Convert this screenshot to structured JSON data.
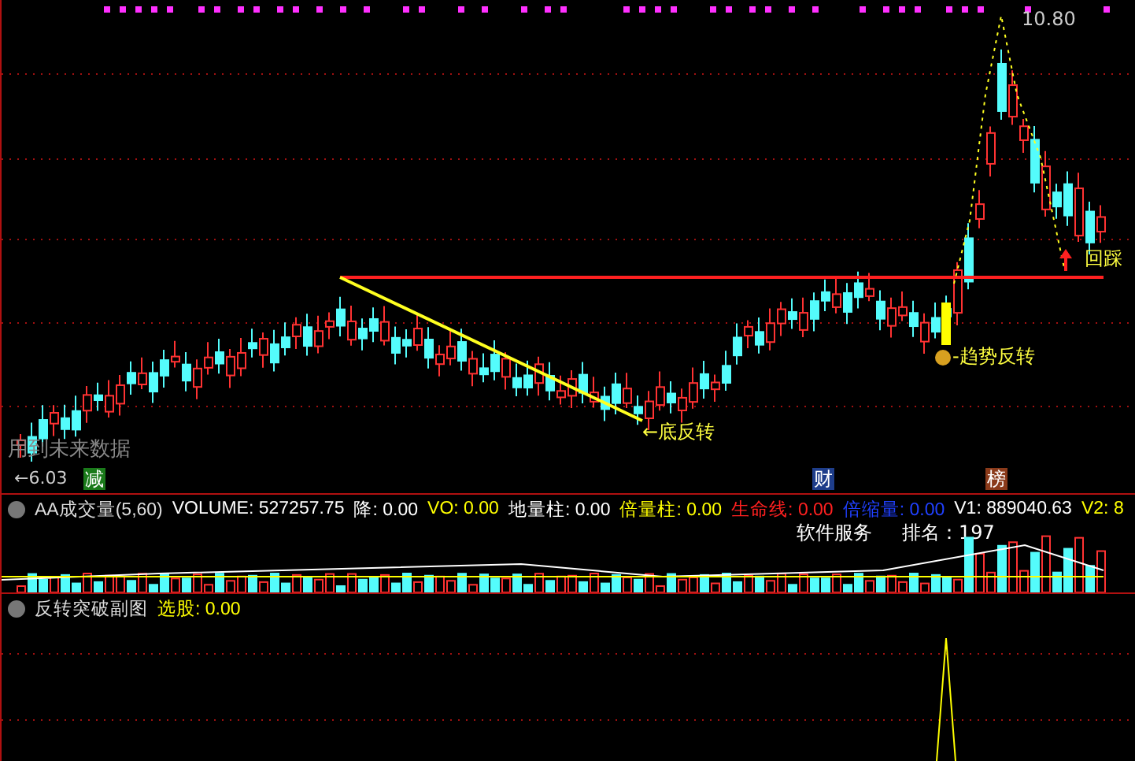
{
  "main_chart": {
    "high_label": "10.80",
    "low_label": "←6.03",
    "overlay_text": "用到未来数据",
    "markers": [
      {
        "text": "减",
        "color": "#1a7a1a"
      },
      {
        "text": "财",
        "color": "#1e3d8a"
      },
      {
        "text": "榜",
        "color": "#8a3a1a"
      }
    ],
    "signals": [
      {
        "kind": "bottom",
        "text": "←底反转"
      },
      {
        "kind": "trend",
        "text": "-趋势反转"
      },
      {
        "kind": "pullback",
        "text": "回踩"
      }
    ]
  },
  "volume_panel": {
    "title": "AA成交量(5,60)",
    "values": [
      {
        "label": "VOLUME:",
        "value": "527257.75",
        "color": "#ffffff"
      },
      {
        "label": "降:",
        "value": "0.00",
        "color": "#ffffff"
      },
      {
        "label": "VO:",
        "value": "0.00",
        "color": "#ffff00"
      },
      {
        "label": "地量柱:",
        "value": "0.00",
        "color": "#ffffff"
      },
      {
        "label": "倍量柱:",
        "value": "0.00",
        "color": "#ffff00"
      },
      {
        "label": "生命线:",
        "value": "0.00",
        "color": "#ff2020"
      },
      {
        "label": "倍缩量:",
        "value": "0.00",
        "color": "#2040ff"
      },
      {
        "label": "V1:",
        "value": "889040.63",
        "color": "#ffffff"
      },
      {
        "label": "V2:",
        "value": "8",
        "color": "#ffff00"
      }
    ],
    "info": [
      "软件服务",
      "排名：197"
    ]
  },
  "signal_panel": {
    "title": "反转突破副图",
    "values": [
      {
        "label": "选股:",
        "value": "0.00",
        "color": "#ffff00"
      }
    ]
  }
}
